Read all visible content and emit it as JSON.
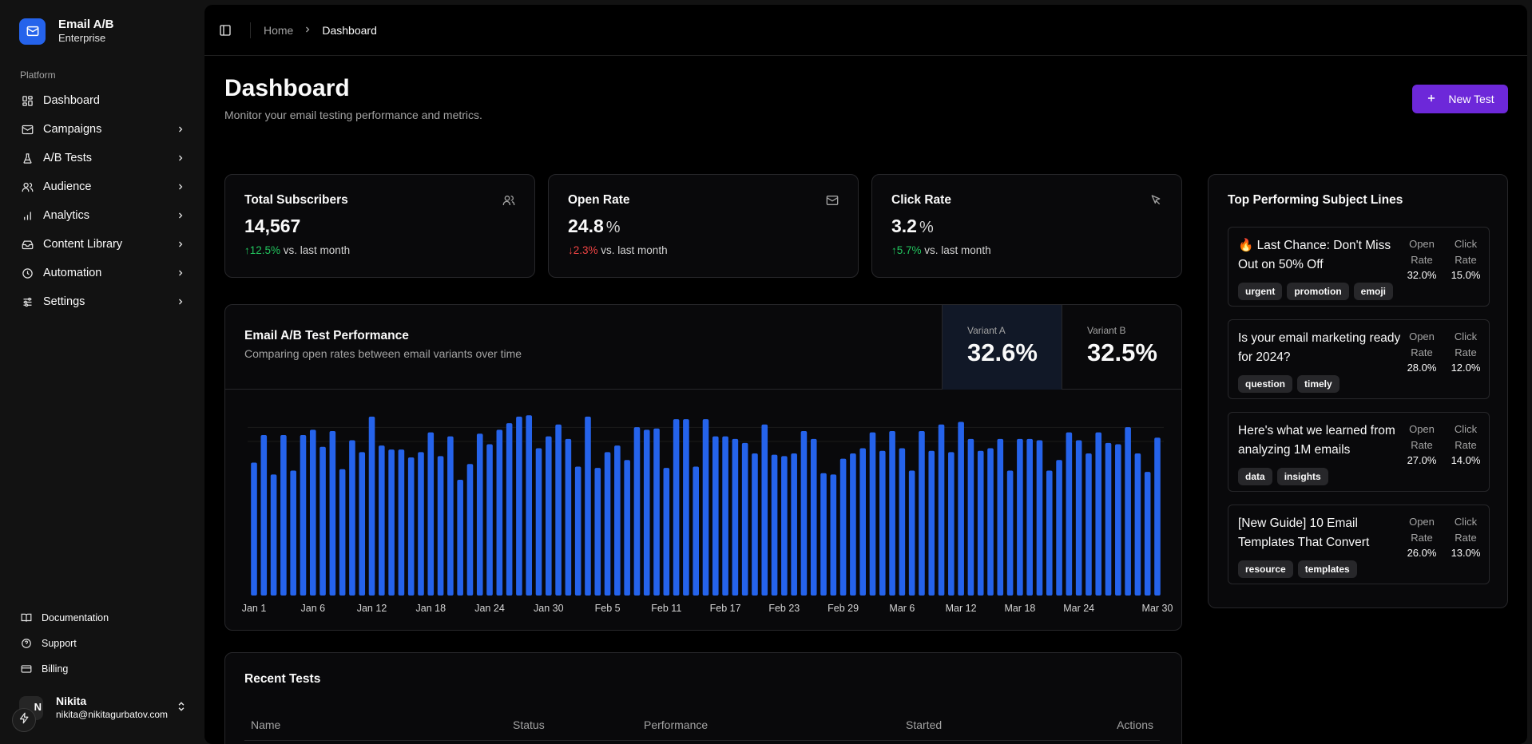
{
  "brand": {
    "name": "Email A/B",
    "plan": "Enterprise"
  },
  "sidebar": {
    "section_label": "Platform",
    "items": [
      {
        "label": "Dashboard",
        "icon": "dashboard-icon"
      },
      {
        "label": "Campaigns",
        "icon": "mail-icon"
      },
      {
        "label": "A/B Tests",
        "icon": "flask-icon"
      },
      {
        "label": "Audience",
        "icon": "users-icon"
      },
      {
        "label": "Analytics",
        "icon": "bar-chart-icon"
      },
      {
        "label": "Content Library",
        "icon": "inbox-icon"
      },
      {
        "label": "Automation",
        "icon": "clock-icon"
      },
      {
        "label": "Settings",
        "icon": "sliders-icon"
      }
    ],
    "secondary": [
      {
        "label": "Documentation",
        "icon": "book-icon"
      },
      {
        "label": "Support",
        "icon": "help-icon"
      },
      {
        "label": "Billing",
        "icon": "credit-card-icon"
      }
    ],
    "user": {
      "name": "Nikita",
      "email": "nikita@nikitagurbatov.com",
      "avatar_fallback": "N"
    }
  },
  "breadcrumb": {
    "home": "Home",
    "current": "Dashboard"
  },
  "header": {
    "title": "Dashboard",
    "subtitle": "Monitor your email testing performance and metrics.",
    "new_test_label": "New Test"
  },
  "stats": [
    {
      "title": "Total Subscribers",
      "value": "14,567",
      "unit": "",
      "change": "↑12.5%",
      "change_dir": "up",
      "suffix": "vs. last month",
      "icon": "users-icon"
    },
    {
      "title": "Open Rate",
      "value": "24.8",
      "unit": "%",
      "change": "↓2.3%",
      "change_dir": "down",
      "suffix": "vs. last month",
      "icon": "mail-icon"
    },
    {
      "title": "Click Rate",
      "value": "3.2",
      "unit": "%",
      "change": "↑5.7%",
      "change_dir": "up",
      "suffix": "vs. last month",
      "icon": "cursor-icon"
    }
  ],
  "performance": {
    "title": "Email A/B Test Performance",
    "subtitle": "Comparing open rates between email variants over time",
    "variant_a": {
      "label": "Variant A",
      "value": "32.6%"
    },
    "variant_b": {
      "label": "Variant B",
      "value": "32.5%"
    }
  },
  "chart_data": {
    "type": "bar",
    "series": [
      {
        "values": [
          30.1,
          32.2,
          29.2,
          32.2,
          29.5,
          32.2,
          32.6,
          31.3,
          32.5,
          29.6,
          31.8,
          30.9,
          33.6,
          31.4,
          31.1,
          31.1,
          30.5,
          30.9,
          32.4,
          30.6,
          32.1,
          28.8,
          30.0,
          32.3,
          31.5,
          32.6,
          33.1,
          33.6,
          33.7,
          31.2,
          32.1,
          33.0,
          31.9,
          29.8,
          33.6,
          29.7,
          30.9,
          31.4,
          30.3,
          32.8,
          32.6,
          32.7,
          29.7,
          33.4,
          33.4,
          29.8,
          33.4,
          32.1,
          32.1,
          31.9,
          31.6,
          30.8,
          33.0,
          30.7,
          30.6,
          30.8,
          32.5,
          31.9,
          29.3,
          29.2,
          30.4,
          30.8,
          31.2,
          32.4,
          31.0,
          32.5,
          31.2,
          29.5,
          32.5,
          31.0,
          33.0,
          30.9,
          33.2,
          31.9,
          31.0,
          31.2,
          31.9,
          29.5,
          31.9,
          31.9,
          31.8,
          29.5,
          30.3,
          32.4,
          31.8,
          30.8,
          32.4,
          31.6,
          31.5,
          32.8,
          30.8,
          29.4,
          32.0
        ]
      }
    ],
    "x_tick_labels": [
      "Jan 1",
      "Jan 6",
      "Jan 12",
      "Jan 18",
      "Jan 24",
      "Jan 30",
      "Feb 5",
      "Feb 11",
      "Feb 17",
      "Feb 23",
      "Feb 29",
      "Mar 6",
      "Mar 12",
      "Mar 18",
      "Mar 24",
      "Mar 30"
    ],
    "bar_color": "#2563eb",
    "grid": true
  },
  "top_subjects": {
    "title": "Top Performing Subject Lines",
    "open_label": "Open Rate",
    "click_label": "Click Rate",
    "items": [
      {
        "text": "🔥 Last Chance: Don't Miss Out on 50% Off",
        "tags": [
          "urgent",
          "promotion",
          "emoji"
        ],
        "open": "32.0%",
        "click": "15.0%"
      },
      {
        "text": "Is your email marketing ready for 2024?",
        "tags": [
          "question",
          "timely"
        ],
        "open": "28.0%",
        "click": "12.0%"
      },
      {
        "text": "Here's what we learned from analyzing 1M emails",
        "tags": [
          "data",
          "insights"
        ],
        "open": "27.0%",
        "click": "14.0%"
      },
      {
        "text": "[New Guide] 10 Email Templates That Convert",
        "tags": [
          "resource",
          "templates"
        ],
        "open": "26.0%",
        "click": "13.0%"
      }
    ]
  },
  "recent_tests": {
    "title": "Recent Tests",
    "columns": [
      "Name",
      "Status",
      "Performance",
      "Started",
      "Actions"
    ]
  }
}
